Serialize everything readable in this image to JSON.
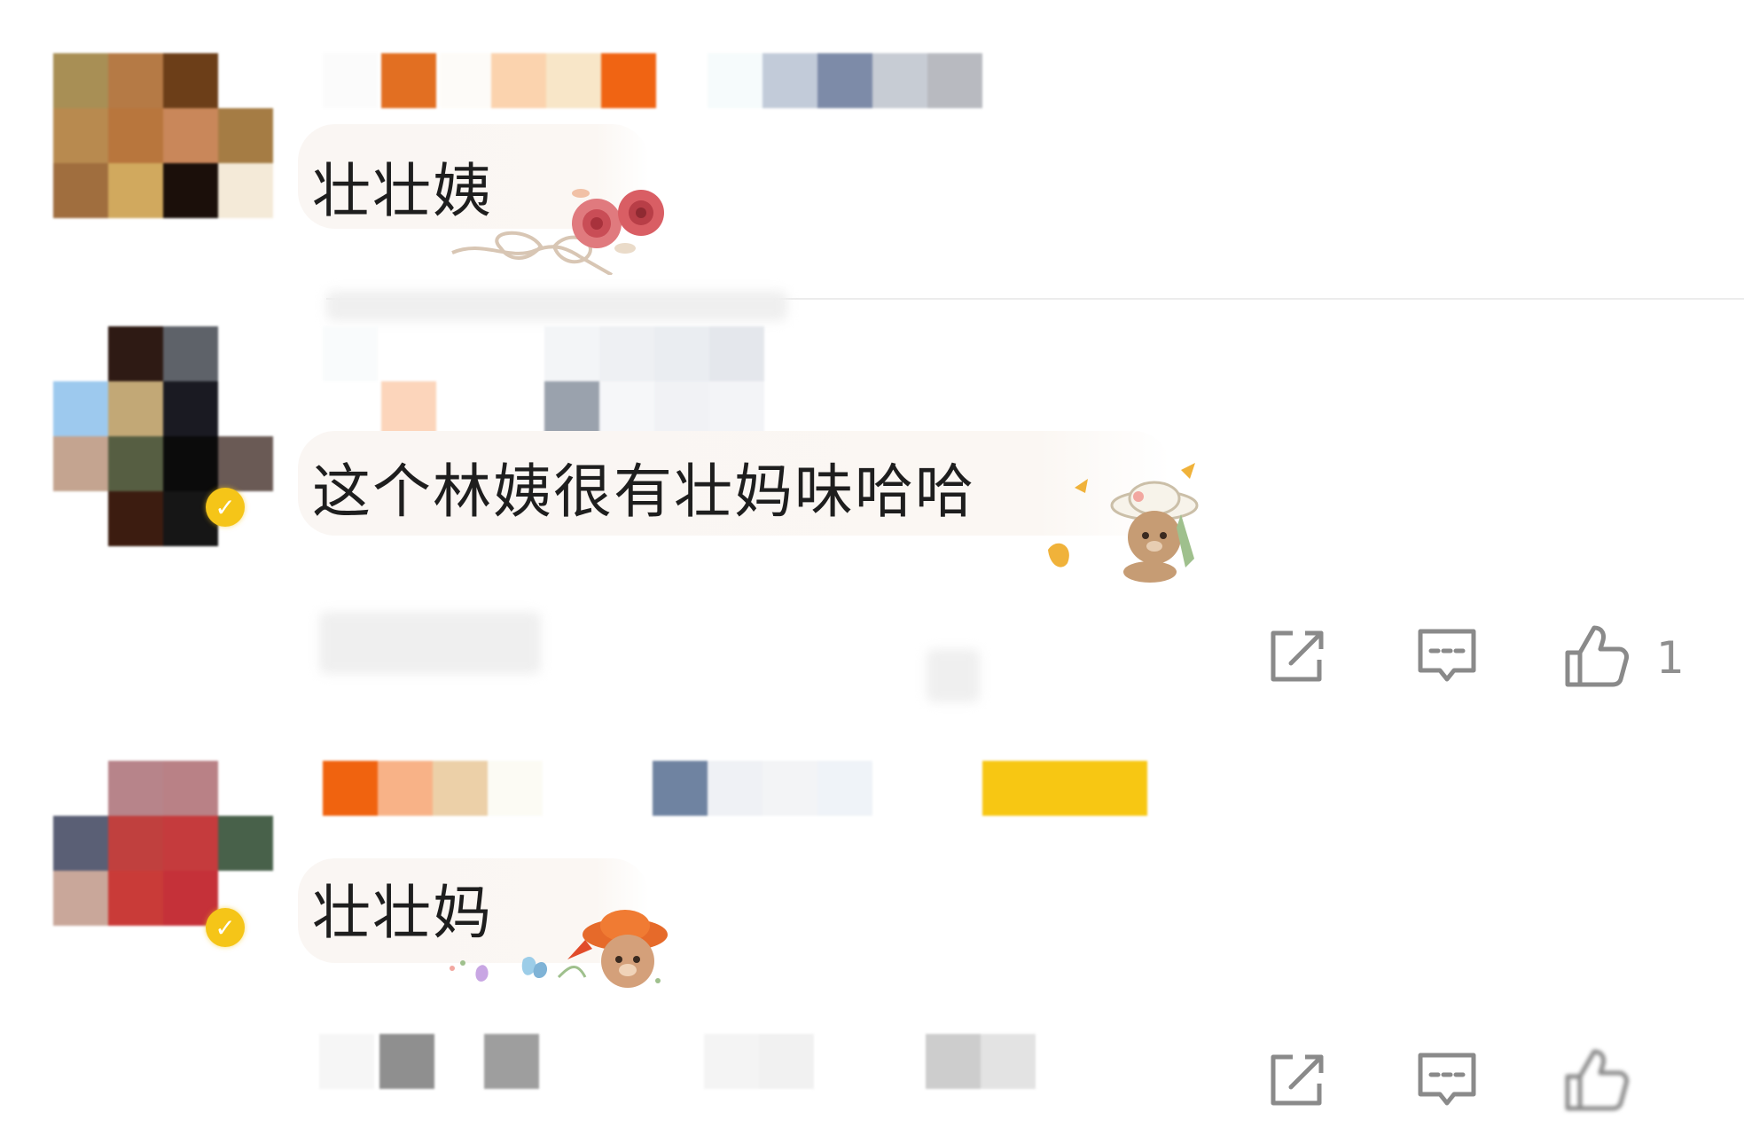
{
  "comments": [
    {
      "text": "壮壮姨",
      "sticker": "roses-bow-sticker",
      "actions": {
        "share_icon": "share-icon",
        "reply_icon": "reply-icon",
        "like_icon": "like-icon",
        "like_count": ""
      }
    },
    {
      "text": "这个林姨很有壮妈味哈哈",
      "sticker": "bear-sunhat-ginkgo-sticker",
      "badge_icon": "verified-badge-icon",
      "actions": {
        "share_icon": "share-icon",
        "reply_icon": "reply-icon",
        "like_icon": "like-icon",
        "like_count": "1"
      }
    },
    {
      "text": "壮壮妈",
      "sticker": "bear-red-hat-sticker",
      "badge_icon": "verified-badge-icon",
      "actions": {
        "share_icon": "share-icon",
        "reply_icon": "reply-icon",
        "like_icon": "like-icon",
        "like_count": ""
      }
    }
  ],
  "colors": {
    "text": "#1e1e1e",
    "icon_gray": "#8a8a8a",
    "count_gray": "#8f8f8f",
    "badge_yellow": "#f5c518",
    "bubble_bg": "#faf6f3"
  }
}
